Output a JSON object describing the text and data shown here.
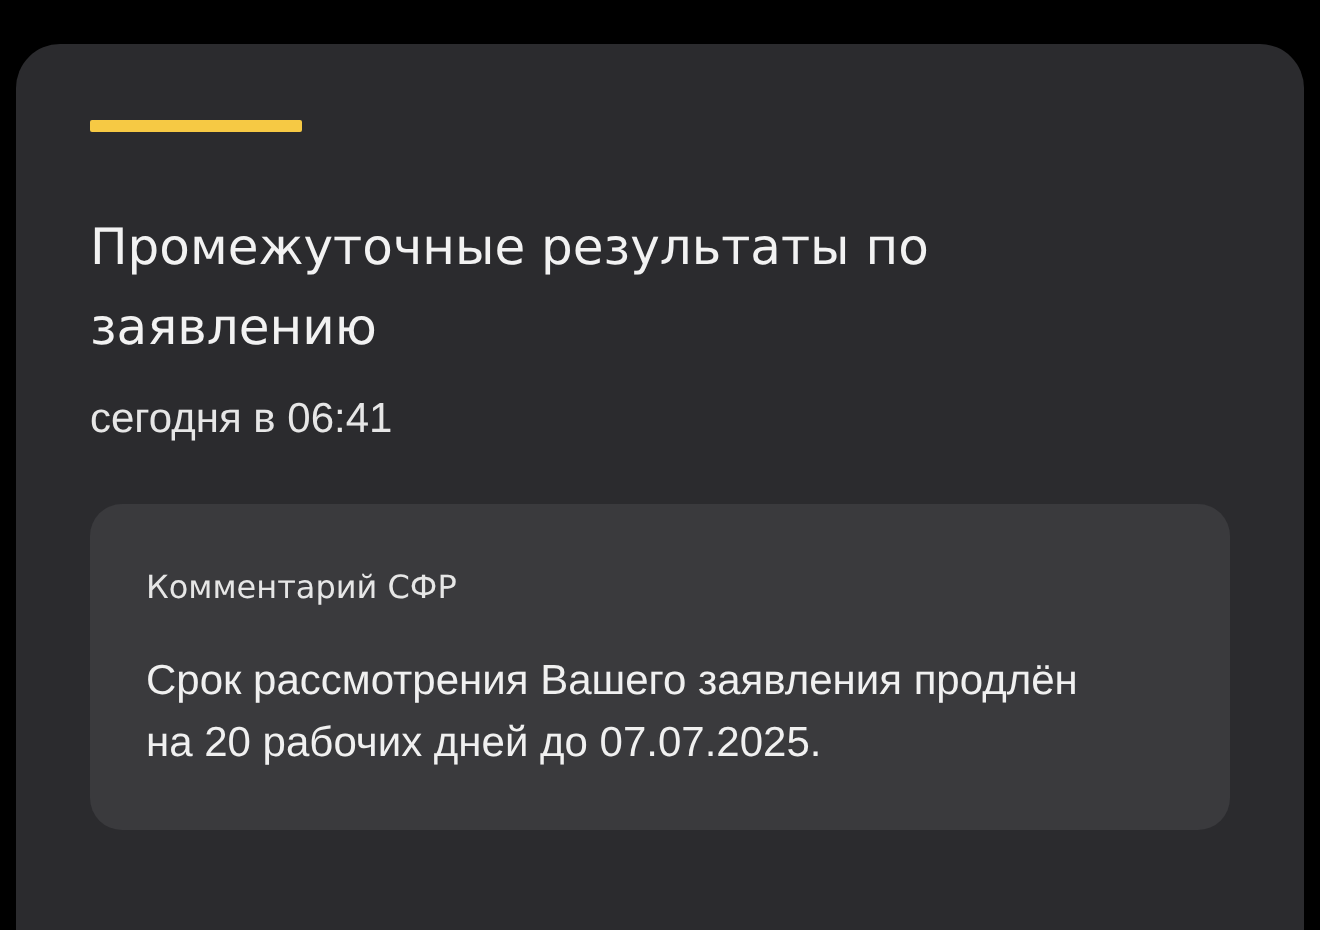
{
  "notification": {
    "title": "Промежуточные результаты по заявлению",
    "time": "сегодня в 06:41",
    "comment": {
      "heading": "Комментарий СФР",
      "text": "Срок рассмотрения Вашего заявления продлён на 20 рабочих дней до 07.07.2025."
    }
  }
}
